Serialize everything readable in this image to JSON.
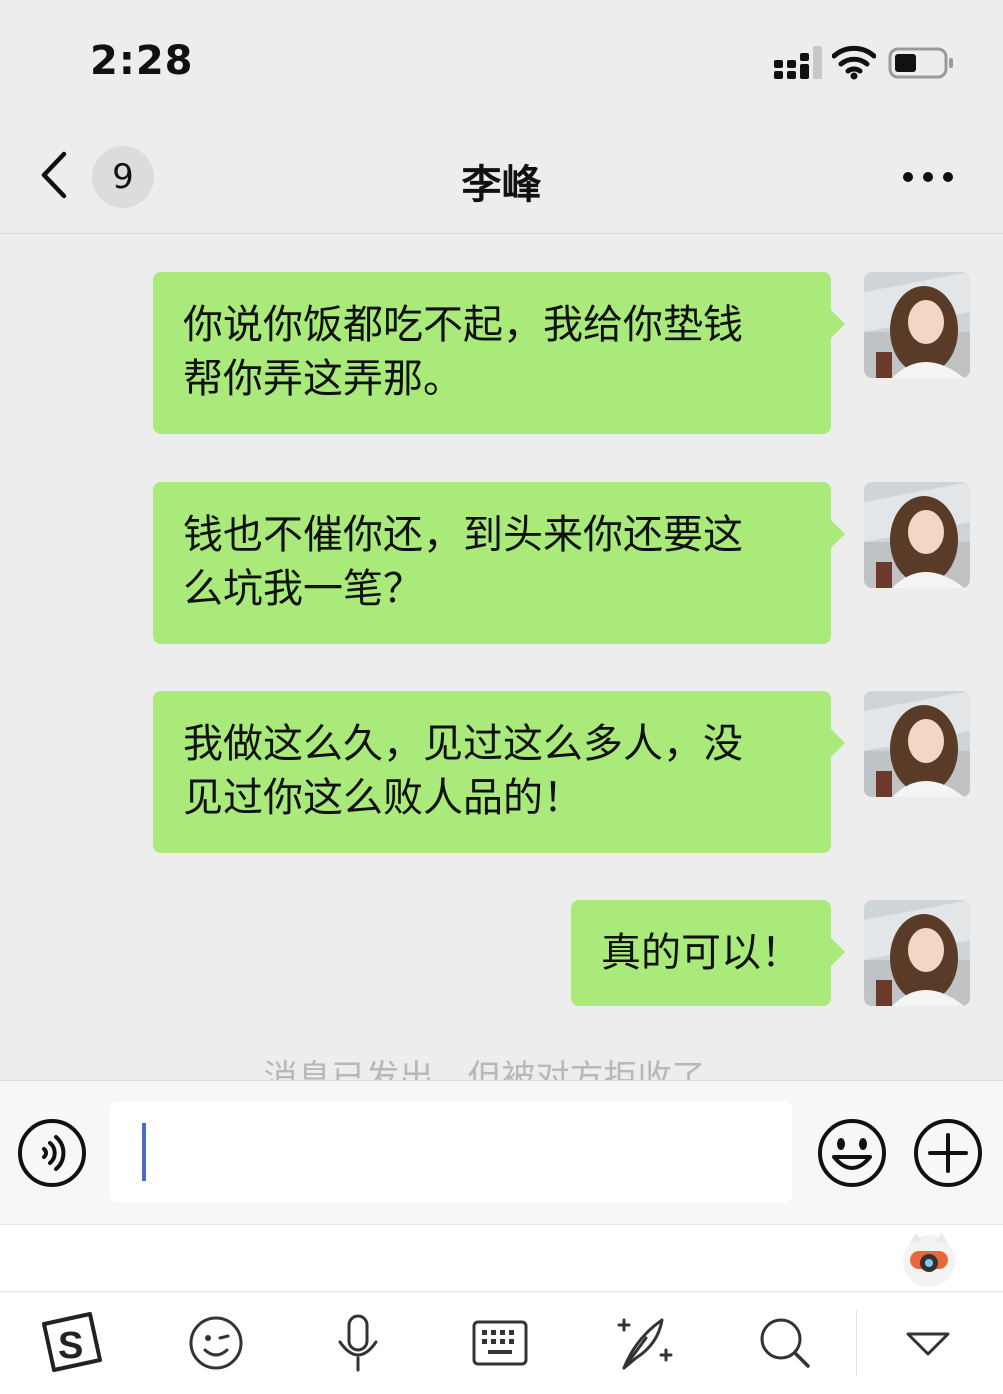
{
  "status_bar": {
    "time": "2:28",
    "battery_level": 0.45
  },
  "nav": {
    "title": "李峰",
    "unread_count": "9"
  },
  "messages": [
    {
      "sender": "self",
      "text": "你说你饭都吃不起，我给你垫钱\n帮你弄这弄那。"
    },
    {
      "sender": "self",
      "text": "钱也不催你还，到头来你还要这\n么坑我一笔？"
    },
    {
      "sender": "self",
      "text": "我做这么久，见过这么多人，没\n见过你这么败人品的！"
    },
    {
      "sender": "self",
      "text": "真的可以！"
    }
  ],
  "system_notice": "消息已发出，但被对方拒收了。",
  "input": {
    "value": ""
  },
  "colors": {
    "bubble": "#a9ea7a",
    "background": "#ededed",
    "caret": "#4a6ad8"
  },
  "ime_toolbar_icons": [
    "sogou-logo-icon",
    "emoji-icon",
    "microphone-icon",
    "keyboard-icon",
    "handwriting-icon",
    "search-icon",
    "collapse-icon"
  ]
}
